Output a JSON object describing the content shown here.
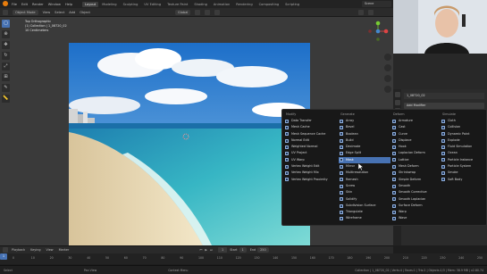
{
  "app": {
    "menus": [
      "File",
      "Edit",
      "Render",
      "Window",
      "Help"
    ],
    "workspaces": [
      "Layout",
      "Modeling",
      "Sculpting",
      "UV Editing",
      "Texture Paint",
      "Shading",
      "Animation",
      "Rendering",
      "Compositing",
      "Scripting"
    ],
    "active_workspace": "Layout",
    "scene": "Scene"
  },
  "viewport_header": {
    "mode": "Object Mode",
    "menus": [
      "View",
      "Select",
      "Add",
      "Object"
    ],
    "orientation": "Global"
  },
  "overlay": {
    "line1": "Top Orthographic",
    "line2": "(1) Collection | 1_08720_02",
    "line3": "10 Centimeters"
  },
  "properties": {
    "object_name": "1_08720_02",
    "add_modifier_label": "Add Modifier"
  },
  "modifier_menu": {
    "columns": [
      {
        "header": "Modify",
        "items": [
          "Data Transfer",
          "Mesh Cache",
          "Mesh Sequence Cache",
          "Normal Edit",
          "Weighted Normal",
          "UV Project",
          "UV Warp",
          "Vertex Weight Edit",
          "Vertex Weight Mix",
          "Vertex Weight Proximity"
        ]
      },
      {
        "header": "Generate",
        "items": [
          "Array",
          "Bevel",
          "Boolean",
          "Build",
          "Decimate",
          "Edge Split",
          "Mask",
          "Mirror",
          "Multiresolution",
          "Remesh",
          "Screw",
          "Skin",
          "Solidify",
          "Subdivision Surface",
          "Triangulate",
          "Wireframe"
        ]
      },
      {
        "header": "Deform",
        "items": [
          "Armature",
          "Cast",
          "Curve",
          "Displace",
          "Hook",
          "Laplacian Deform",
          "Lattice",
          "Mesh Deform",
          "Shrinkwrap",
          "Simple Deform",
          "Smooth",
          "Smooth Corrective",
          "Smooth Laplacian",
          "Surface Deform",
          "Warp",
          "Wave"
        ]
      },
      {
        "header": "Simulate",
        "items": [
          "Cloth",
          "Collision",
          "Dynamic Paint",
          "Explode",
          "Fluid Simulation",
          "Ocean",
          "Particle Instance",
          "Particle System",
          "Smoke",
          "Soft Body"
        ]
      }
    ],
    "selected": "Mask"
  },
  "timeline": {
    "menus": [
      "Playback",
      "Keying",
      "View",
      "Marker"
    ],
    "current_frame": "1",
    "start_label": "Start",
    "start": "1",
    "end_label": "End",
    "end": "250",
    "ticks": [
      "0",
      "10",
      "20",
      "30",
      "40",
      "50",
      "60",
      "70",
      "80",
      "90",
      "100",
      "110",
      "120",
      "130",
      "140",
      "150",
      "160",
      "170",
      "180",
      "190",
      "200",
      "210",
      "220",
      "230",
      "240",
      "250"
    ]
  },
  "status_bar": {
    "left": "Select",
    "middle_left": "Pan View",
    "middle": "Context Menu",
    "right": "Collection | 1_08720_02 | Verts:4 | Faces:1 | Tris:2 | Objects:1/3 | Mem: 38.9 MB | v2.80.74"
  },
  "colors": {
    "accent": "#4772b3",
    "menu_bg": "#181818",
    "sea": "#3fb8c0",
    "sand": "#e9d9b4",
    "sky": "#2f7fce"
  }
}
